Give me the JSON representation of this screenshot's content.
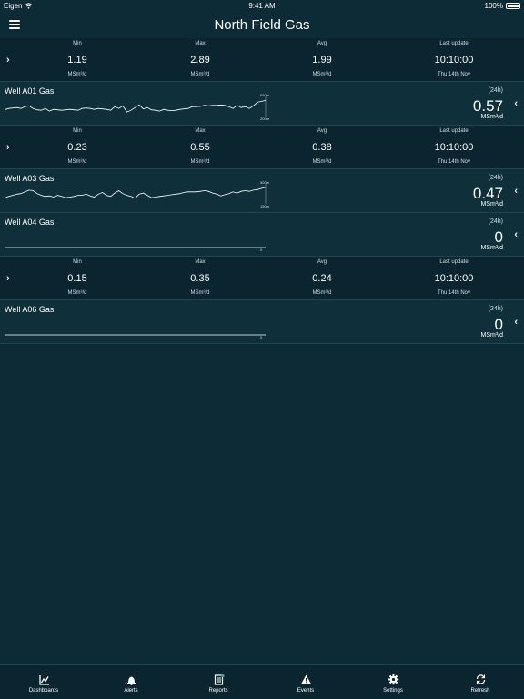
{
  "status": {
    "carrier": "Eigen",
    "time": "9:41 AM",
    "battery": "100%"
  },
  "header": {
    "title": "North Field Gas"
  },
  "rows": [
    {
      "type": "stats",
      "min_label": "Min",
      "max_label": "Max",
      "avg_label": "Avg",
      "upd_label": "Last update",
      "min": "1.19",
      "max": "2.89",
      "avg": "1.99",
      "updated_time": "10:10:00",
      "unit": "MSm³/d",
      "updated_date": "Thu 14th Nov"
    },
    {
      "type": "chart",
      "name": "Well A01 Gas",
      "period": "(24h)",
      "value": "0.57",
      "unit": "MSm³/d",
      "axis_top": "650m",
      "axis_bottom": "200m",
      "series": [
        350,
        380,
        390,
        400,
        380,
        420,
        440,
        380,
        350,
        340,
        380,
        320,
        360,
        350,
        340,
        350,
        360,
        350,
        340,
        380,
        390,
        380,
        360,
        380,
        370,
        360,
        340,
        420,
        380,
        440,
        300,
        340,
        400,
        460,
        370,
        400,
        350,
        340,
        320,
        360,
        340,
        330,
        340,
        360,
        370,
        380,
        420,
        420,
        430,
        450,
        440,
        450,
        450,
        460,
        450,
        420,
        380,
        450,
        400,
        420,
        380,
        440,
        520,
        540,
        560
      ]
    },
    {
      "type": "stats",
      "min_label": "Min",
      "max_label": "Max",
      "avg_label": "Avg",
      "upd_label": "Last update",
      "min": "0.23",
      "max": "0.55",
      "avg": "0.38",
      "updated_time": "10:10:00",
      "unit": "MSm³/d",
      "updated_date": "Thu 14th Nov"
    },
    {
      "type": "chart",
      "name": "Well A03 Gas",
      "period": "(24h)",
      "value": "0.47",
      "unit": "MSm³/d",
      "axis_top": "500m",
      "axis_bottom": "150m",
      "series": [
        250,
        280,
        300,
        320,
        330,
        360,
        390,
        380,
        330,
        300,
        280,
        290,
        270,
        300,
        280,
        260,
        270,
        280,
        300,
        300,
        320,
        290,
        270,
        320,
        350,
        300,
        280,
        340,
        380,
        330,
        300,
        280,
        250,
        320,
        340,
        300,
        260,
        270,
        280,
        290,
        300,
        310,
        320,
        330,
        350,
        360,
        360,
        360,
        370,
        380,
        370,
        340,
        320,
        290,
        310,
        330,
        360,
        340,
        370,
        380,
        370,
        390,
        400,
        420,
        440
      ]
    },
    {
      "type": "chart",
      "name": "Well A04 Gas",
      "period": "(24h)",
      "value": "0",
      "unit": "MSm³/d",
      "axis_top": "",
      "axis_bottom": "0",
      "series": [
        0,
        0
      ]
    },
    {
      "type": "stats",
      "min_label": "Min",
      "max_label": "Max",
      "avg_label": "Avg",
      "upd_label": "Last update",
      "min": "0.15",
      "max": "0.35",
      "avg": "0.24",
      "updated_time": "10:10:00",
      "unit": "MSm³/d",
      "updated_date": "Thu 14th Nov"
    },
    {
      "type": "chart",
      "name": "Well A06 Gas",
      "period": "(24h)",
      "value": "0",
      "unit": "MSm³/d",
      "axis_top": "",
      "axis_bottom": "0",
      "series": [
        0,
        0
      ]
    }
  ],
  "tabs": [
    {
      "label": "Dashboards",
      "icon": "chart-icon"
    },
    {
      "label": "Alerts",
      "icon": "bell-icon"
    },
    {
      "label": "Reports",
      "icon": "report-icon"
    },
    {
      "label": "Events",
      "icon": "warning-icon"
    },
    {
      "label": "Settings",
      "icon": "gear-icon"
    },
    {
      "label": "Refresh",
      "icon": "refresh-icon"
    }
  ],
  "colors": {
    "background": "#0d2b36",
    "text": "#ffffff"
  }
}
